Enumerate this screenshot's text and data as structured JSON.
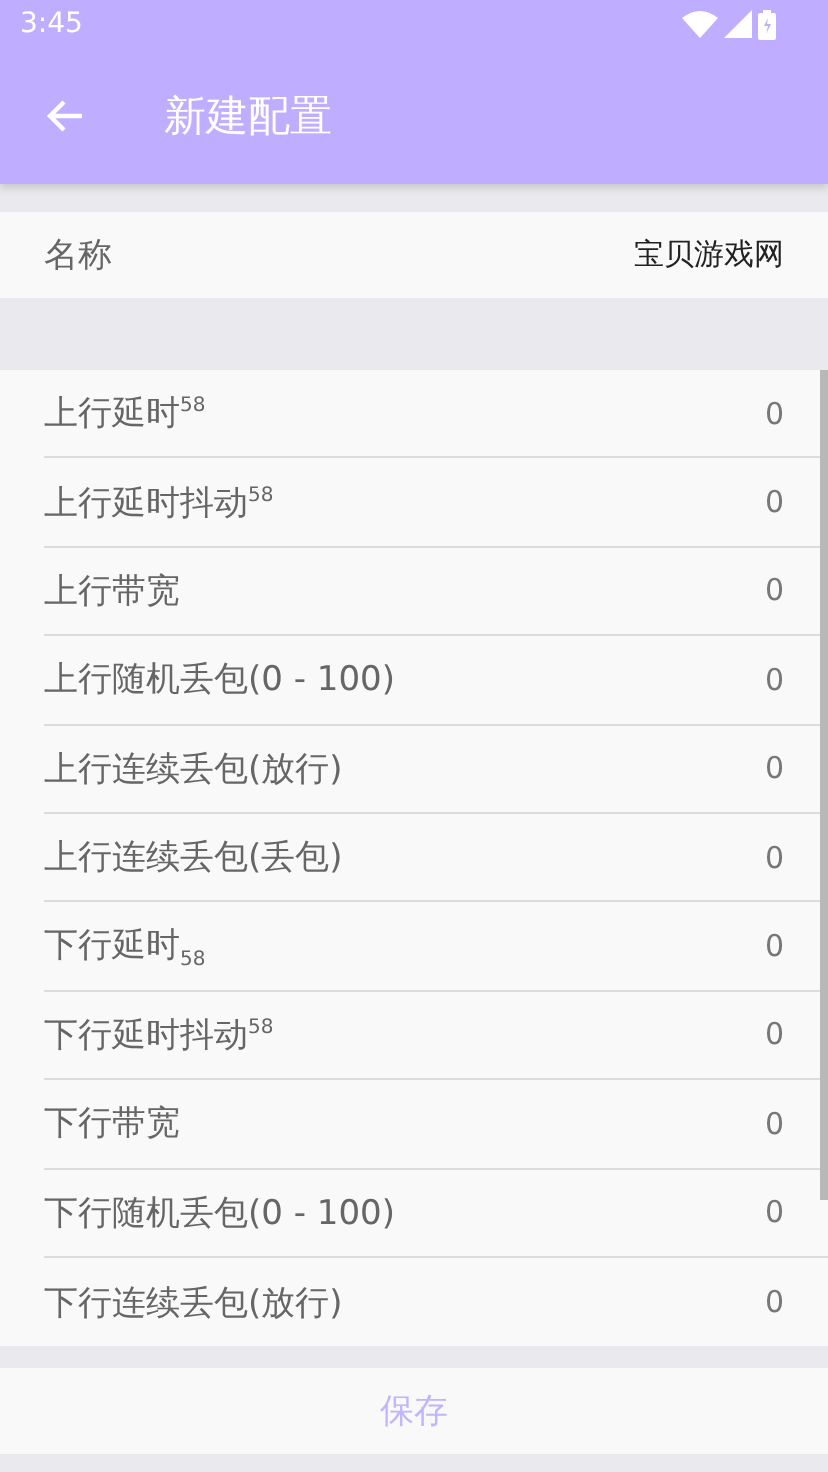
{
  "status_bar": {
    "time": "3:45"
  },
  "toolbar": {
    "title": "新建配置"
  },
  "name_row": {
    "label": "名称",
    "value": "宝贝游戏网"
  },
  "settings": [
    {
      "label": "上行延时$^{58}$",
      "value": "0"
    },
    {
      "label": "上行延时抖动$^{58}$",
      "value": "0"
    },
    {
      "label": "上行带宽",
      "value": "0"
    },
    {
      "label": "上行随机丢包(0 - 100)",
      "value": "0"
    },
    {
      "label": "上行连续丢包(放行)",
      "value": "0"
    },
    {
      "label": "上行连续丢包(丢包)",
      "value": "0"
    },
    {
      "label": "下行延时$_{58}$",
      "value": "0"
    },
    {
      "label": "下行延时抖动$^{58}$",
      "value": "0"
    },
    {
      "label": "下行带宽",
      "value": "0"
    },
    {
      "label": "下行随机丢包(0 - 100)",
      "value": "0"
    },
    {
      "label": "下行连续丢包(放行)",
      "value": "0"
    }
  ],
  "save_button": {
    "label": "保存"
  }
}
